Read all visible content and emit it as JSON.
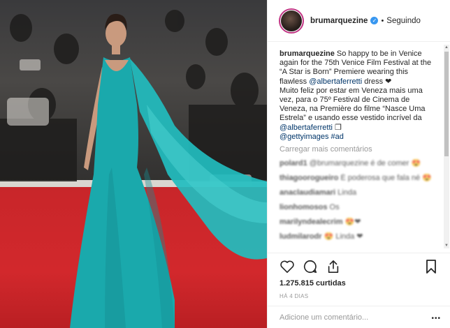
{
  "header": {
    "username": "brumarquezine",
    "verified_mark": "✓",
    "separator": "•",
    "follow_status": "Seguindo"
  },
  "caption": {
    "username": "brumarquezine",
    "text_en_1": " So happy to be in Venice again for the 75th Venice Film Festival at the “A Star is Born” Premiere wearing this flawless ",
    "mention_en": "@albertaferretti",
    "text_en_2": " dress ❤",
    "text_pt_1": "Muito feliz por estar em Veneza mais uma vez, para o 75º Festival de Cinema de Veneza, na Première do filme “Nasce Uma Estrela” e usando esse vestido incrível da ",
    "mention_pt": "@albertaferretti",
    "text_pt_2": " ❐",
    "mention_getty": "@gettyimages",
    "hashtag": "#ad"
  },
  "load_more": "Carregar mais comentários",
  "comments": [
    {
      "user": "polard1",
      "text": "@brumarquezine é de comer 😍"
    },
    {
      "user": "thiagoorogueiro",
      "text": "É poderosa que fala né 😍"
    },
    {
      "user": "anaclaudiamari",
      "text": "Linda"
    },
    {
      "user": "lionhomosos",
      "text": "Os"
    },
    {
      "user": "marilyndealecrim",
      "text": "😍❤"
    },
    {
      "user": "ludmilarodr",
      "text": "😍 Linda ❤"
    }
  ],
  "likes": "1.275.815 curtidas",
  "timestamp": "HÁ 4 DIAS",
  "add_comment": {
    "placeholder": "Adicione um comentário..."
  },
  "icons": {
    "like": "heart-icon",
    "comment": "comment-icon",
    "share": "share-icon",
    "save": "bookmark-icon",
    "more": "more-options-icon"
  },
  "colors": {
    "accent_link": "#003569",
    "verified": "#3897f0",
    "dress": "#1fb3b5",
    "carpet": "#c8262a"
  }
}
